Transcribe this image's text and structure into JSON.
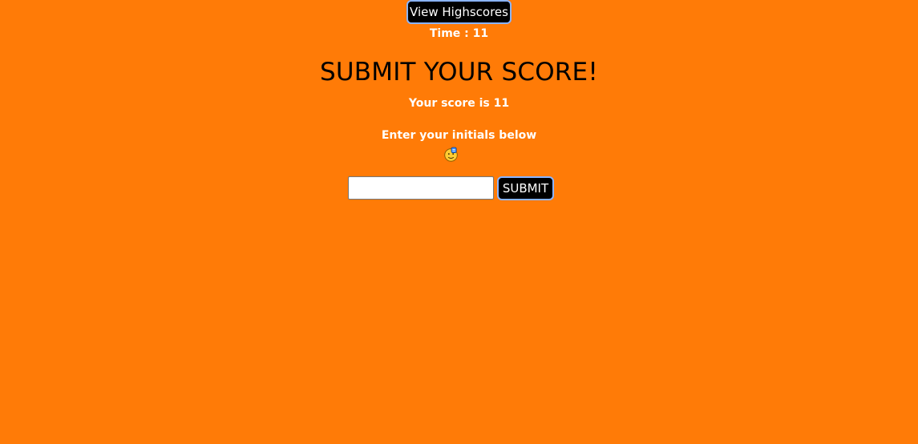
{
  "header": {
    "highscores_label": "View Highscores",
    "time_text": "Time : 11"
  },
  "main": {
    "title": "SUBMIT YOUR SCORE!",
    "score_text": "Your score is 11",
    "instruction": "Enter your initials below",
    "emoji_icon": "pointing-down-emoji-icon",
    "initials_value": "",
    "submit_label": "SUBMIT"
  },
  "colors": {
    "background": "#ff7b07",
    "button_bg": "#000000",
    "button_border": "#8ab4ff",
    "text_light": "#ffffff",
    "title_text": "#000000"
  }
}
